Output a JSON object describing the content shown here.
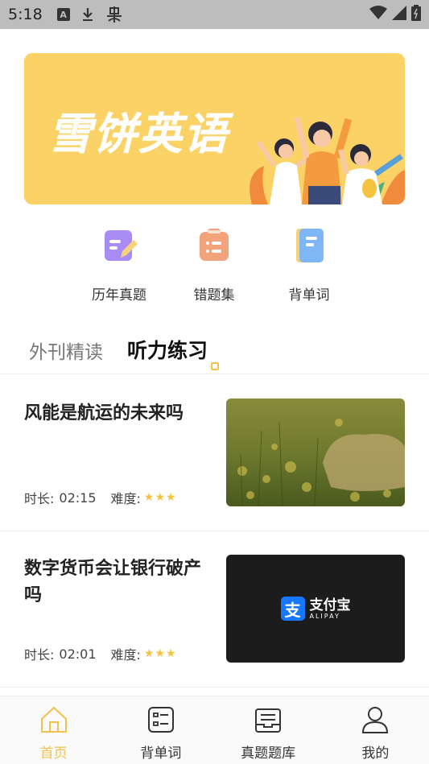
{
  "status_bar": {
    "time": "5:18",
    "icons": [
      "a-notification-icon",
      "download-icon",
      "bug-icon",
      "wifi-icon",
      "signal-icon",
      "battery-icon"
    ]
  },
  "banner": {
    "title": "雪饼英语",
    "background": "#fbd266"
  },
  "shortcuts": [
    {
      "label": "历年真题",
      "icon": "edit-note-icon",
      "color": "#a98bf5"
    },
    {
      "label": "错题集",
      "icon": "clipboard-icon",
      "color": "#f3a37b"
    },
    {
      "label": "背单词",
      "icon": "notebook-icon",
      "color": "#7fb6f5"
    }
  ],
  "tabs": [
    {
      "label": "外刊精读",
      "active": false
    },
    {
      "label": "听力练习",
      "active": true
    }
  ],
  "articles": [
    {
      "title": "风能是航运的未来吗",
      "duration_label": "时长:",
      "duration": "02:15",
      "difficulty_label": "难度:",
      "stars": "★★★"
    },
    {
      "title": "数字货币会让银行破产吗",
      "duration_label": "时长:",
      "duration": "02:01",
      "difficulty_label": "难度:",
      "stars": "★★★",
      "thumb_brand": "支付宝",
      "thumb_brand_sub": "ALIPAY"
    }
  ],
  "bottom_nav": [
    {
      "label": "首页",
      "icon": "home-icon",
      "active": true
    },
    {
      "label": "背单词",
      "icon": "word-card-icon",
      "active": false
    },
    {
      "label": "真题题库",
      "icon": "question-bank-icon",
      "active": false
    },
    {
      "label": "我的",
      "icon": "user-icon",
      "active": false
    }
  ],
  "colors": {
    "accent": "#f2c14b",
    "star": "#f6c340"
  }
}
